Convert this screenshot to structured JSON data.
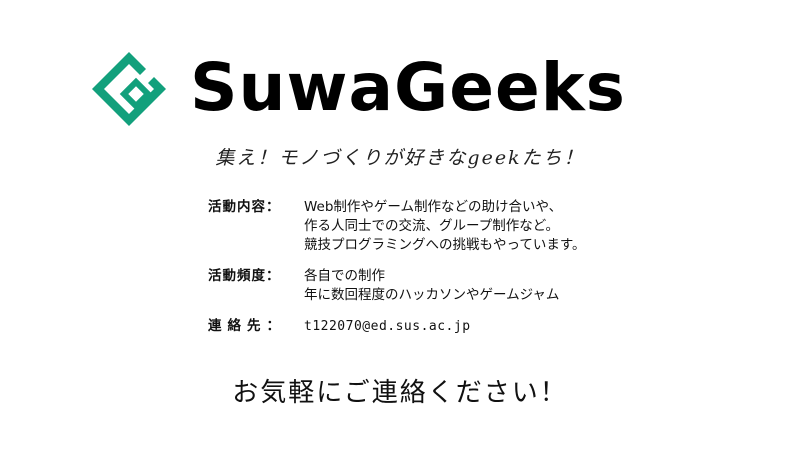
{
  "brand": {
    "name": "SuwaGeeks",
    "tagline": "集え！モノづくりが好きなgeekたち！",
    "logo_icon": "diamond-g-logo-icon",
    "accent_color": "#12a07c"
  },
  "info": {
    "activity": {
      "label": "活動内容：",
      "lines": [
        "Web制作やゲーム制作などの助け合いや、",
        "作る人同士での交流、グループ制作など。",
        "競技プログラミングへの挑戦もやっています。"
      ]
    },
    "frequency": {
      "label": "活動頻度：",
      "lines": [
        "各自での制作",
        "年に数回程度のハッカソンやゲームジャム"
      ]
    },
    "contact": {
      "label": "連絡先：",
      "value": "t122070@ed.sus.ac.jp"
    }
  },
  "cta": "お気軽にご連絡ください！"
}
